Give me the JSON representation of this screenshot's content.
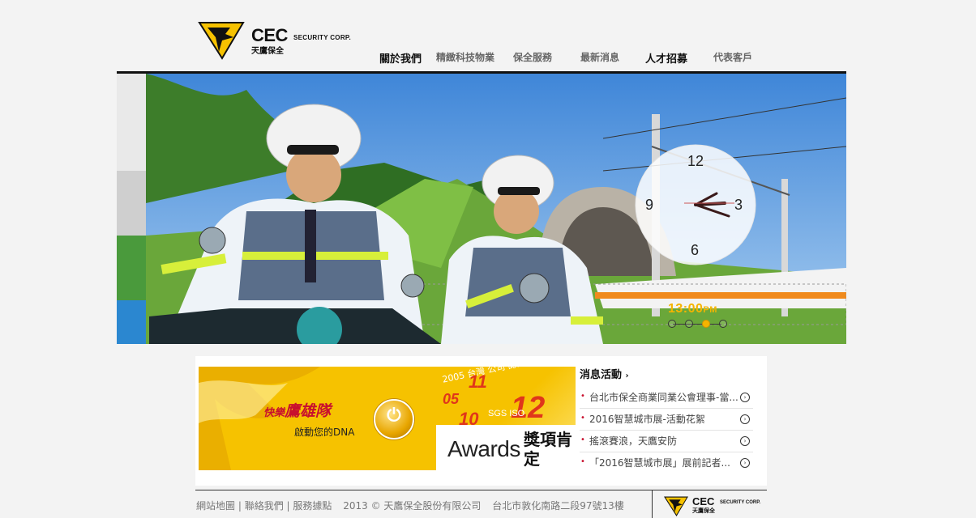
{
  "header": {
    "brand": "CEC",
    "corp": "SECURITY CORP.",
    "brand_cn": "天鷹保全"
  },
  "nav": [
    {
      "label": "關於我們"
    },
    {
      "label": "精緻科技物業"
    },
    {
      "label": "保全服務"
    },
    {
      "label": "最新消息"
    },
    {
      "label": "人才招募"
    },
    {
      "label": "代表客戶"
    }
  ],
  "banner": {
    "clock": {
      "n12": "12",
      "n3": "3",
      "n6": "6",
      "n9": "9"
    },
    "time": "13:00",
    "ampm": "PM",
    "slides": 4,
    "active_slide": 3
  },
  "promo": {
    "title_prefix": "快樂",
    "title_main": "鷹雄隊",
    "subtitle": "啟動您的DNA",
    "power_symbol": "⏻"
  },
  "award": {
    "line1": "2005 台灣 公司 認證",
    "n05": "05",
    "n11": "11",
    "n10": "10",
    "n12": "12",
    "sgs": "SGS ISO",
    "awards": "Awards",
    "cn": "獎項肯定"
  },
  "news": {
    "title": "消息活動",
    "items": [
      {
        "text": "台北市保全商業同業公會理事-當..."
      },
      {
        "text": "2016智慧城市展-活動花絮"
      },
      {
        "text": "搖滾賽浪，天鷹安防"
      },
      {
        "text": "「2016智慧城市展」展前記者..."
      }
    ]
  },
  "footer": {
    "sitemap": "網站地圖",
    "contact": "聯絡我們",
    "service": "服務據點",
    "copyright": "2013 © 天鷹保全股份有限公司",
    "address": "台北市敦化南路二段97號13樓"
  },
  "colors": {
    "accent": "#f6c200",
    "red": "#c8102e",
    "dark": "#111111"
  }
}
